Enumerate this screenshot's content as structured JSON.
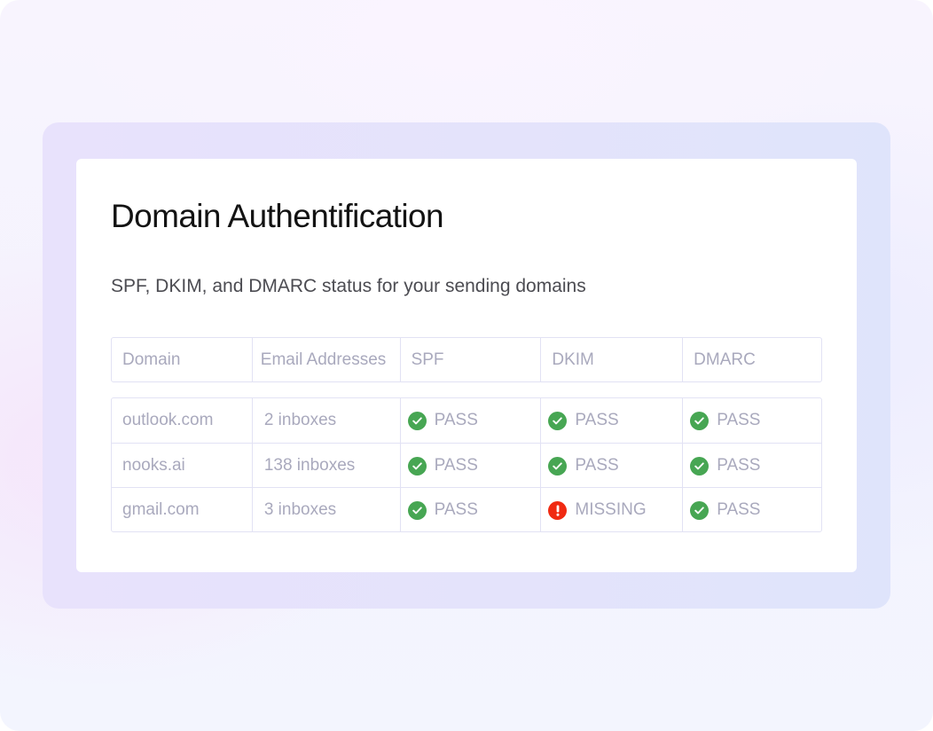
{
  "title": "Domain Authentification",
  "subtitle": "SPF, DKIM, and DMARC status for your sending domains",
  "table": {
    "headers": [
      "Domain",
      "Email Addresses",
      "SPF",
      "DKIM",
      "DMARC"
    ],
    "rows": [
      {
        "domain": "outlook.com",
        "emails": "2 inboxes",
        "spf": "PASS",
        "dkim": "PASS",
        "dmarc": "PASS"
      },
      {
        "domain": "nooks.ai",
        "emails": "138 inboxes",
        "spf": "PASS",
        "dkim": "PASS",
        "dmarc": "PASS"
      },
      {
        "domain": "gmail.com",
        "emails": "3 inboxes",
        "spf": "PASS",
        "dkim": "MISSING",
        "dmarc": "PASS"
      }
    ]
  },
  "status_colors": {
    "pass": "#47a653",
    "missing": "#f02a12"
  },
  "icons": {
    "pass": "check-circle-icon",
    "missing": "exclamation-circle-icon"
  }
}
